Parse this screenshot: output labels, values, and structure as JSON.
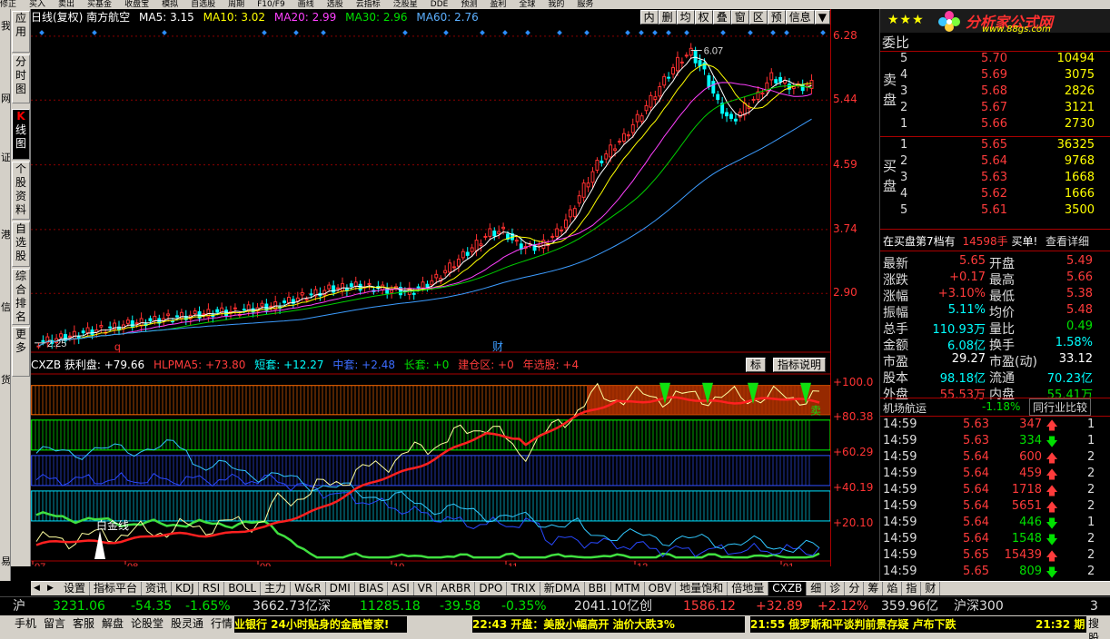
{
  "top_menu": [
    "修正",
    "买入",
    "卖出",
    "买基金",
    "收盘宝",
    "模拟",
    "自选股",
    "周期",
    "F10/F9",
    "画线",
    "选股",
    "云指标",
    "泛股星",
    "DDE",
    "预测",
    "盈利",
    "全球",
    "我的",
    "服务"
  ],
  "vertical_tabs": [
    {
      "label": "应用",
      "id": "app"
    },
    {
      "label": "分时图",
      "id": "timeshare"
    },
    {
      "label": "K线图",
      "id": "kline",
      "icon": "K"
    },
    {
      "label": "个股资料",
      "id": "stockinfo"
    },
    {
      "label": "自选股",
      "id": "watchlist"
    },
    {
      "label": "综合排名",
      "id": "ranking"
    },
    {
      "label": "更多",
      "id": "more"
    }
  ],
  "far_left_chars": [
    "我",
    "网",
    "证",
    "港",
    "信",
    "货",
    "易"
  ],
  "main_chart": {
    "legend": {
      "title": "日线(复权) 南方航空",
      "ma5": "MA5: 3.15",
      "ma10": "MA10: 3.02",
      "ma20": "MA20: 2.99",
      "ma30": "MA30: 2.96",
      "ma60": "MA60: 2.76"
    },
    "toolbar": [
      "内",
      "删",
      "均",
      "权",
      "叠",
      "窗",
      "区",
      "预",
      "信息",
      "▼"
    ],
    "price_labels": [
      "6.28",
      "5.44",
      "4.59",
      "3.74",
      "2.90"
    ],
    "high_label": "6.07",
    "low_label": "2.25",
    "markers": [
      "q",
      "财"
    ],
    "month_labels": [
      "07",
      "08",
      "09",
      "10",
      "11",
      "12",
      "01"
    ],
    "colors": {
      "up": "#ff3030",
      "down": "#00ffff",
      "ma5": "#ffffff",
      "ma10": "#ffff00",
      "ma20": "#ff40ff",
      "ma30": "#00d000",
      "ma60": "#3c9cff",
      "grid": "#8a0000"
    }
  },
  "indicator": {
    "legend": {
      "name": "CXZB 获利盘: +79.66",
      "hlp": "HLPMA5: +73.80",
      "short": "短套: +12.27",
      "mid": "中套: +2.48",
      "long": "长套: +0",
      "build": "建仓区: +0",
      "year": "年选股: +4"
    },
    "btn_small": "标",
    "btn_explain": "指标说明",
    "axis_labels": [
      "+100.0",
      "+80.38",
      "+60.29",
      "+40.19",
      "+20.10"
    ],
    "buy_label": "白金线",
    "sell_label": "卖"
  },
  "chart_data": {
    "type": "line",
    "title": "日线(复权) 南方航空",
    "x_months": [
      "07",
      "08",
      "09",
      "10",
      "11",
      "12",
      "01"
    ],
    "ylim": [
      2.2,
      6.35
    ],
    "y_ticks": [
      6.28,
      5.44,
      4.59,
      3.74,
      2.9
    ],
    "series": [
      {
        "name": "MA5",
        "last": 3.15
      },
      {
        "name": "MA10",
        "last": 3.02
      },
      {
        "name": "MA20",
        "last": 2.99
      },
      {
        "name": "MA30",
        "last": 2.96
      },
      {
        "name": "MA60",
        "last": 2.76
      }
    ],
    "close_path": [
      2.25,
      2.28,
      2.32,
      2.35,
      2.4,
      2.43,
      2.46,
      2.5,
      2.52,
      2.55,
      2.58,
      2.6,
      2.62,
      2.64,
      2.66,
      2.66,
      2.7,
      2.72,
      2.74,
      2.8,
      2.86,
      2.9,
      2.96,
      2.98,
      3.0,
      2.98,
      2.96,
      2.94,
      2.92,
      3.0,
      3.1,
      3.25,
      3.4,
      3.55,
      3.7,
      3.72,
      3.55,
      3.5,
      3.55,
      3.7,
      3.95,
      4.3,
      4.6,
      4.8,
      4.95,
      5.2,
      5.45,
      5.7,
      5.95,
      6.07,
      5.8,
      5.4,
      5.15,
      5.35,
      5.5,
      5.75,
      5.65,
      5.6,
      5.65
    ],
    "high": 6.07,
    "low": 2.25
  },
  "order_book": {
    "header": "委比",
    "sell_title": "卖盘",
    "buy_title": "买盘",
    "sell": [
      {
        "n": "5",
        "p": "5.70",
        "v": "10494"
      },
      {
        "n": "4",
        "p": "5.69",
        "v": "3075"
      },
      {
        "n": "3",
        "p": "5.68",
        "v": "2826"
      },
      {
        "n": "2",
        "p": "5.67",
        "v": "3121"
      },
      {
        "n": "1",
        "p": "5.66",
        "v": "2730"
      }
    ],
    "buy": [
      {
        "n": "1",
        "p": "5.65",
        "v": "36325"
      },
      {
        "n": "2",
        "p": "5.64",
        "v": "9768"
      },
      {
        "n": "3",
        "p": "5.63",
        "v": "1668"
      },
      {
        "n": "4",
        "p": "5.62",
        "v": "1666"
      },
      {
        "n": "5",
        "p": "5.61",
        "v": "3500"
      }
    ],
    "notice_a": "在买盘第7档有",
    "notice_b": "14598手",
    "notice_c": "买单!",
    "notice_link": "查看详细"
  },
  "brand": {
    "stars": "★★★",
    "title": "分析家公式网",
    "url": "www.88gs.com"
  },
  "quote": [
    {
      "k1": "最新",
      "v1": "5.65",
      "k2": "开盘",
      "v2": "5.49"
    },
    {
      "k1": "涨跌",
      "v1": "+0.17",
      "k2": "最高",
      "v2": "5.66"
    },
    {
      "k1": "涨幅",
      "v1": "+3.10%",
      "k2": "最低",
      "v2": "5.38"
    },
    {
      "k1": "振幅",
      "v1": "5.11%",
      "k2": "均价",
      "v2": "5.48"
    },
    {
      "k1": "总手",
      "v1": "110.93万",
      "k2": "量比",
      "v2": "0.49"
    },
    {
      "k1": "金额",
      "v1": "6.08亿",
      "k2": "换手",
      "v2": "1.58%"
    },
    {
      "k1": "市盈",
      "v1": "29.27",
      "k2": "市盈(动)",
      "v2": "33.12"
    },
    {
      "k1": "股本",
      "v1": "98.18亿",
      "k2": "流通",
      "v2": "70.23亿"
    },
    {
      "k1": "外盘",
      "v1": "55.53万",
      "k2": "内盘",
      "v2": "55.41万"
    }
  ],
  "industry": {
    "name": "机场航运",
    "change": "-1.18%",
    "btn": "同行业比较"
  },
  "ticks": [
    {
      "t": "14:59",
      "p": "5.63",
      "v": "347",
      "d": "up",
      "e": "1"
    },
    {
      "t": "14:59",
      "p": "5.63",
      "v": "334",
      "d": "down",
      "e": "1"
    },
    {
      "t": "14:59",
      "p": "5.64",
      "v": "600",
      "d": "up",
      "e": "2"
    },
    {
      "t": "14:59",
      "p": "5.64",
      "v": "459",
      "d": "up",
      "e": "2"
    },
    {
      "t": "14:59",
      "p": "5.64",
      "v": "1718",
      "d": "up",
      "e": "2"
    },
    {
      "t": "14:59",
      "p": "5.64",
      "v": "5651",
      "d": "up",
      "e": "2"
    },
    {
      "t": "14:59",
      "p": "5.64",
      "v": "446",
      "d": "down",
      "e": "1"
    },
    {
      "t": "14:59",
      "p": "5.64",
      "v": "1548",
      "d": "down",
      "e": "2"
    },
    {
      "t": "14:59",
      "p": "5.65",
      "v": "15439",
      "d": "up",
      "e": "2"
    },
    {
      "t": "14:59",
      "p": "5.65",
      "v": "809",
      "d": "down",
      "e": "2"
    }
  ],
  "bottom_tabs": [
    "设置",
    "指标平台",
    "资讯",
    "KDJ",
    "RSI",
    "BOLL",
    "主力",
    "W&R",
    "DMI",
    "BIAS",
    "ASI",
    "VR",
    "ARBR",
    "DPO",
    "TRIX",
    "新DMA",
    "BBI",
    "MTM",
    "OBV",
    "地量饱和",
    "倍地量",
    "CXZB",
    "细",
    "诊",
    "分",
    "筹",
    "焰",
    "指",
    "财"
  ],
  "active_bottom_tab": "CXZB",
  "ticker": [
    {
      "text": "沪",
      "c": "#ddd"
    },
    {
      "text": "3231.06",
      "c": "#00e000"
    },
    {
      "text": "-54.35",
      "c": "#00e000"
    },
    {
      "text": "-1.65%",
      "c": "#00e000"
    },
    {
      "text": "3662.73亿",
      "c": "#ddd"
    },
    {
      "text": "深",
      "c": "#ddd"
    },
    {
      "text": "11285.18",
      "c": "#00e000"
    },
    {
      "text": "-39.58",
      "c": "#00e000"
    },
    {
      "text": "-0.35%",
      "c": "#00e000"
    },
    {
      "text": "2041.10亿",
      "c": "#ddd"
    },
    {
      "text": "创",
      "c": "#ddd"
    },
    {
      "text": "1586.12",
      "c": "#ff3b3b"
    },
    {
      "text": "+32.89",
      "c": "#ff3b3b"
    },
    {
      "text": "+2.12%",
      "c": "#ff3b3b"
    },
    {
      "text": "359.96亿",
      "c": "#ddd"
    },
    {
      "text": "沪深300",
      "c": "#ddd"
    },
    {
      "text": "3",
      "c": "#ddd"
    }
  ],
  "status_buttons": [
    "手机",
    "留言",
    "客服",
    "解盘",
    "论股堂",
    "股灵通",
    "行情"
  ],
  "news": [
    {
      "text": "业银行  24小时贴身的金融管家!"
    },
    {
      "text": "22:43 开盘：美股小幅高开 油价大跌3%"
    },
    {
      "text": "21:55 俄罗斯和平谈判前景存疑 卢布下跌"
    },
    {
      "text": "21:32 期"
    }
  ],
  "status_right": "搜股"
}
